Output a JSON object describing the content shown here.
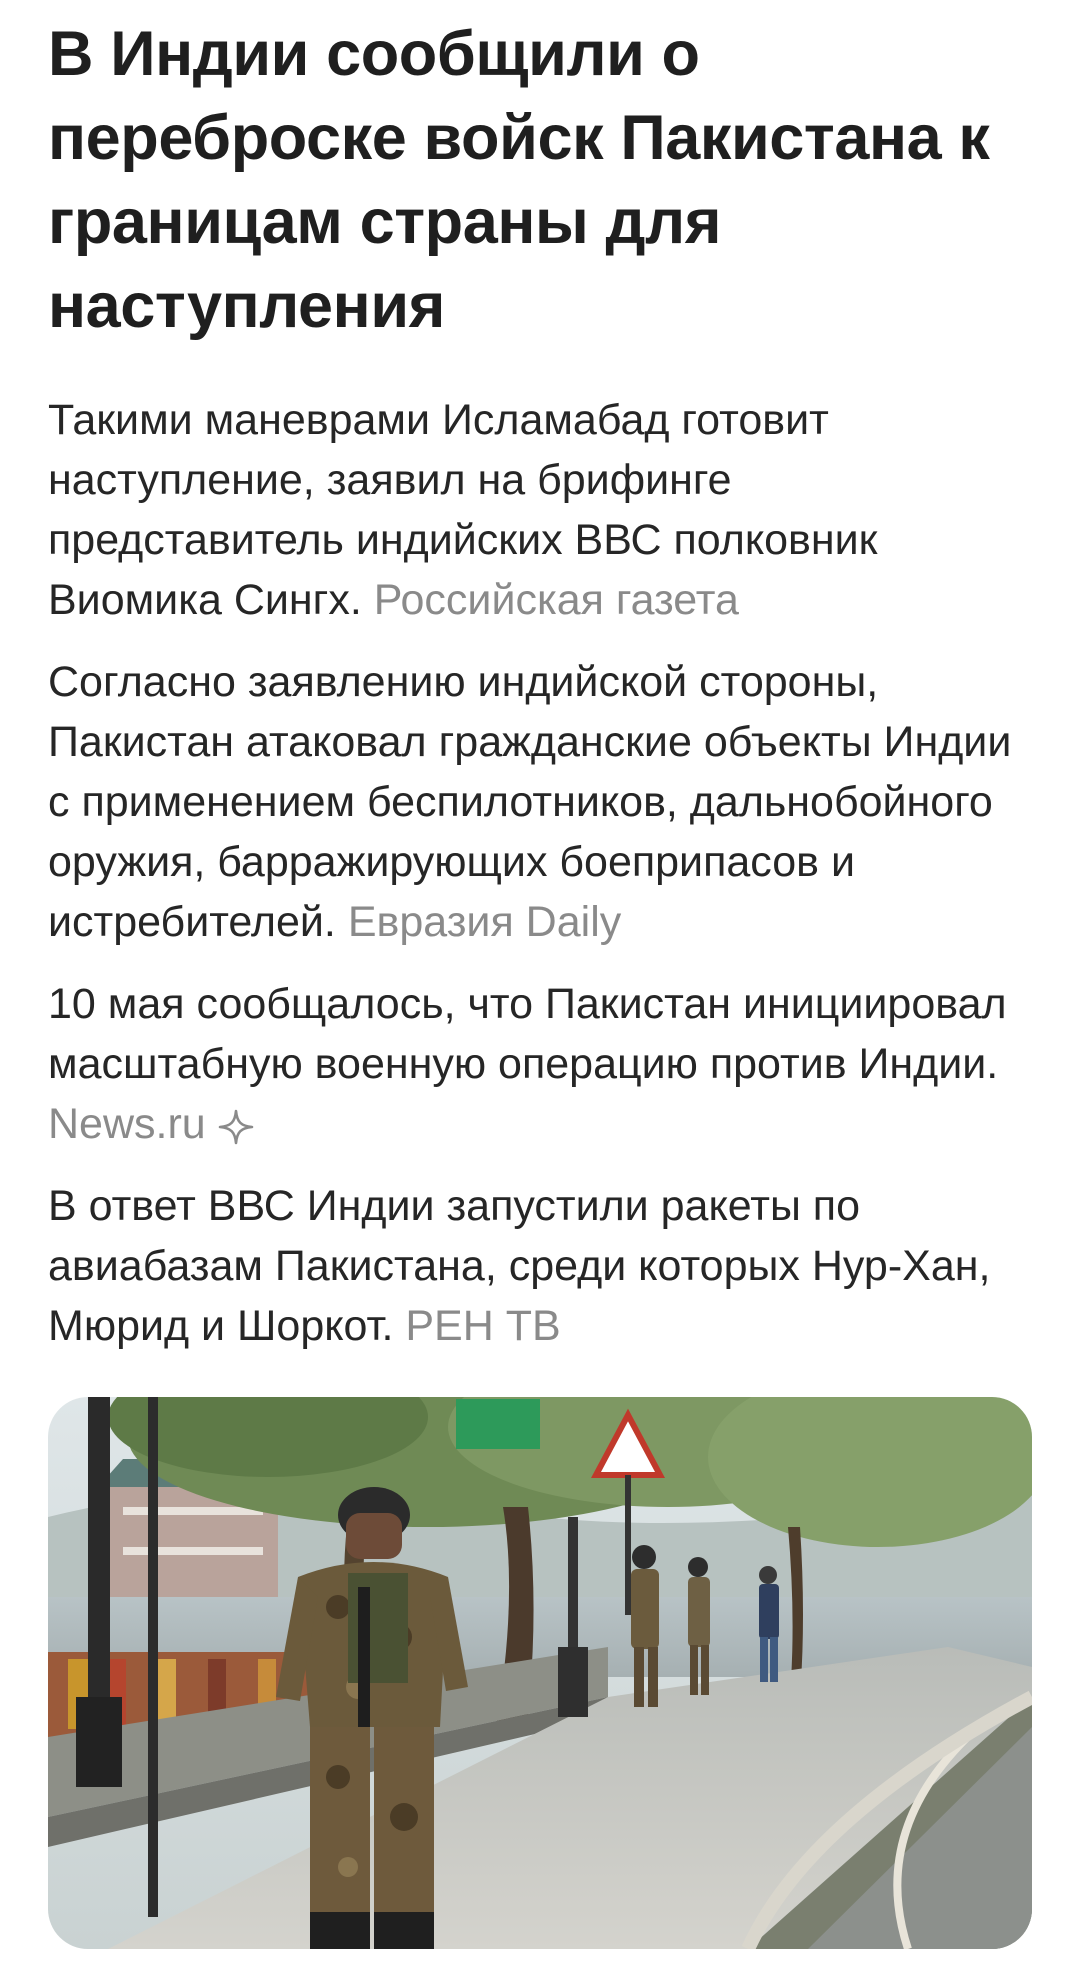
{
  "article": {
    "headline": "В Индии сообщили о переброске войск Пакистана к границам страны для наступления",
    "snippets": [
      {
        "text": "Такими маневрами Исламабад готовит наступление, заявил на брифинге представитель индийских ВВС полковник Виомика Сингх.",
        "source": "Российская газета"
      },
      {
        "text": "Согласно заявлению индийской стороны, Пакистан атаковал гражданские объекты Индии с применением беспилотников, дальнобойного оружия, барражирующих боеприпасов и истребителей.",
        "source": "Евразия Daily"
      },
      {
        "text": "10 мая сообщалось, что Пакистан инициировал масштабную военную операцию против Индии.",
        "source": "News.ru",
        "source_icon": "sparkle-icon"
      },
      {
        "text": "В ответ ВВС Индии запустили ракеты по авиабазам Пакистана, среди которых Нур-Хан, Мюрид и Шоркот.",
        "source": "РЕН ТВ"
      }
    ],
    "photo": {
      "icon": "photo-soldiers-patrolling-promenade"
    }
  },
  "colors": {
    "text": "#262626",
    "headline": "#1f1f1f",
    "source": "#8a8a8a",
    "background": "#ffffff"
  }
}
